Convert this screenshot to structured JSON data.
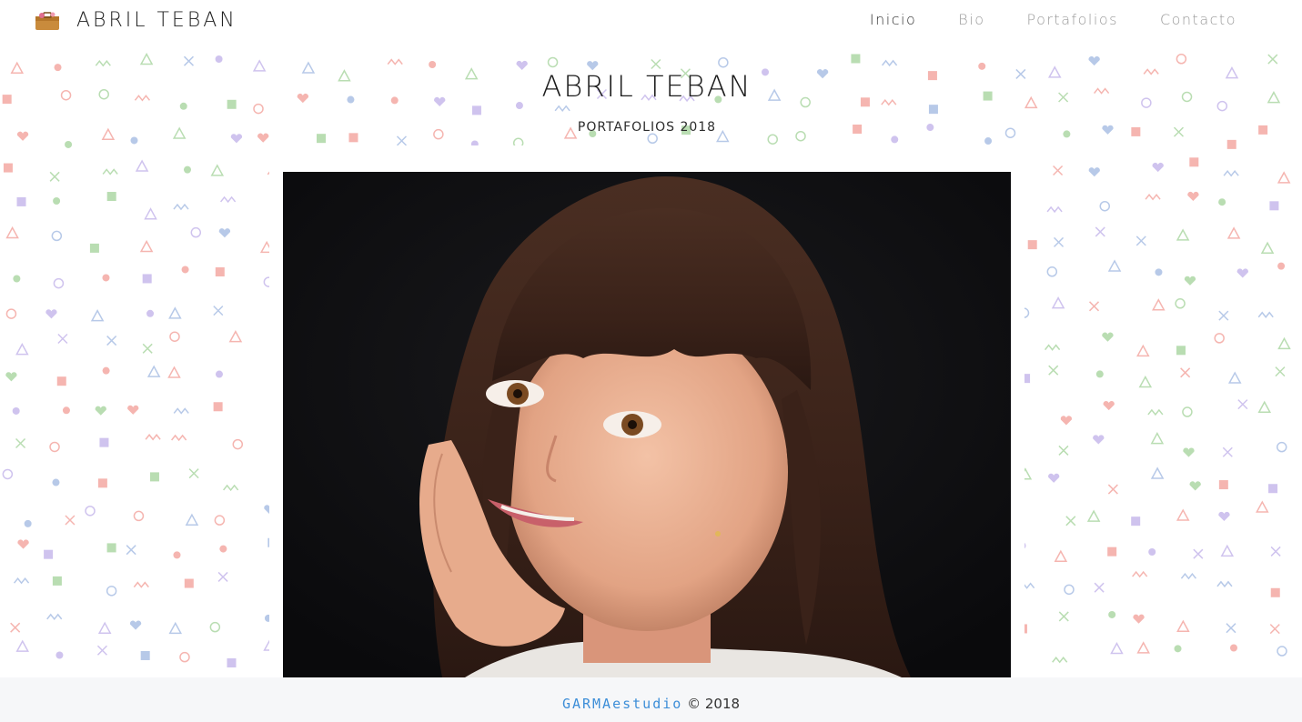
{
  "brand": {
    "name": "ABRIL TEBAN",
    "icon": "suitcase-icon"
  },
  "nav": {
    "items": [
      {
        "label": "Inicio",
        "active": true
      },
      {
        "label": "Bio",
        "active": false
      },
      {
        "label": "Portafolios",
        "active": false
      },
      {
        "label": "Contacto",
        "active": false
      }
    ]
  },
  "hero": {
    "title": "ABRIL TEBAN",
    "subtitle": "PORTAFOLIOS 2018"
  },
  "photo": {
    "alt_icon": "portrait-photo"
  },
  "footer": {
    "studio": "GARMAestudio",
    "copyright": "© 2018"
  },
  "colors": {
    "accent": "#3d8ed8",
    "pattern_pink": "#f5b5b0",
    "pattern_green": "#b9ddb2",
    "pattern_blue": "#b7c9e8",
    "pattern_purple": "#cfc3ee",
    "footer_bg": "#f6f7f9"
  }
}
